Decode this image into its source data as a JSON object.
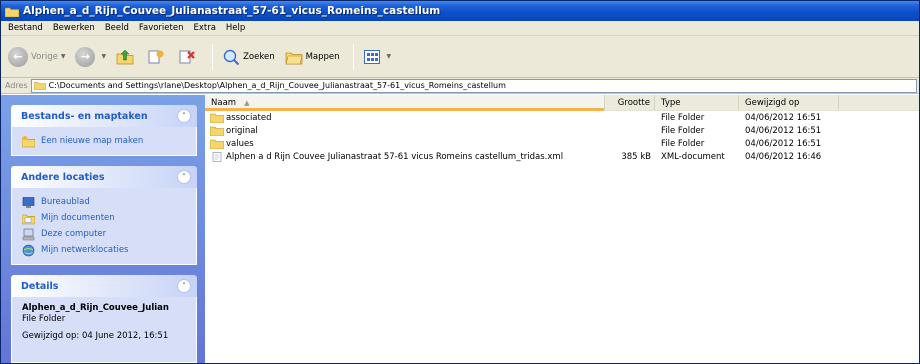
{
  "window": {
    "title": "Alphen_a_d_Rijn_Couvee_Julianastraat_57-61_vicus_Romeins_castellum"
  },
  "menubar": {
    "items": [
      "Bestand",
      "Bewerken",
      "Beeld",
      "Favorieten",
      "Extra",
      "Help"
    ]
  },
  "toolbar": {
    "back_label": "Vorige",
    "search_label": "Zoeken",
    "folders_label": "Mappen"
  },
  "address": {
    "label": "Adres",
    "path": "C:\\Documents and Settings\\rlane\\Desktop\\Alphen_a_d_Rijn_Couvee_Julianastraat_57-61_vicus_Romeins_castellum"
  },
  "sidebar": {
    "tasks": {
      "title": "Bestands- en maptaken",
      "items": [
        {
          "label": "Een nieuwe map maken",
          "icon": "new-folder-icon"
        }
      ]
    },
    "places": {
      "title": "Andere locaties",
      "items": [
        {
          "label": "Bureaublad",
          "icon": "desktop-icon"
        },
        {
          "label": "Mijn documenten",
          "icon": "my-documents-icon"
        },
        {
          "label": "Deze computer",
          "icon": "my-computer-icon"
        },
        {
          "label": "Mijn netwerklocaties",
          "icon": "network-places-icon"
        }
      ]
    },
    "details": {
      "title": "Details",
      "name": "Alphen_a_d_Rijn_Couvee_Julian",
      "type": "File Folder",
      "modified": "Gewijzigd op: 04 June 2012, 16:51"
    }
  },
  "filelist": {
    "columns": {
      "name": "Naam",
      "size": "Grootte",
      "type": "Type",
      "date": "Gewijzigd op"
    },
    "rows": [
      {
        "name": "associated",
        "size": "",
        "type": "File Folder",
        "date": "04/06/2012 16:51",
        "icon": "folder-icon"
      },
      {
        "name": "original",
        "size": "",
        "type": "File Folder",
        "date": "04/06/2012 16:51",
        "icon": "folder-icon"
      },
      {
        "name": "values",
        "size": "",
        "type": "File Folder",
        "date": "04/06/2012 16:51",
        "icon": "folder-icon"
      },
      {
        "name": "Alphen a d Rijn Couvee Julianastraat 57-61 vicus Romeins castellum_tridas.xml",
        "size": "385 kB",
        "type": "XML-document",
        "date": "04/06/2012 16:46",
        "icon": "xml-file-icon"
      }
    ]
  },
  "colors": {
    "titlebar": "#0b4fc8",
    "taskpane": "#6f8de0",
    "link": "#215dc6",
    "sort_highlight": "#f9b24a"
  }
}
